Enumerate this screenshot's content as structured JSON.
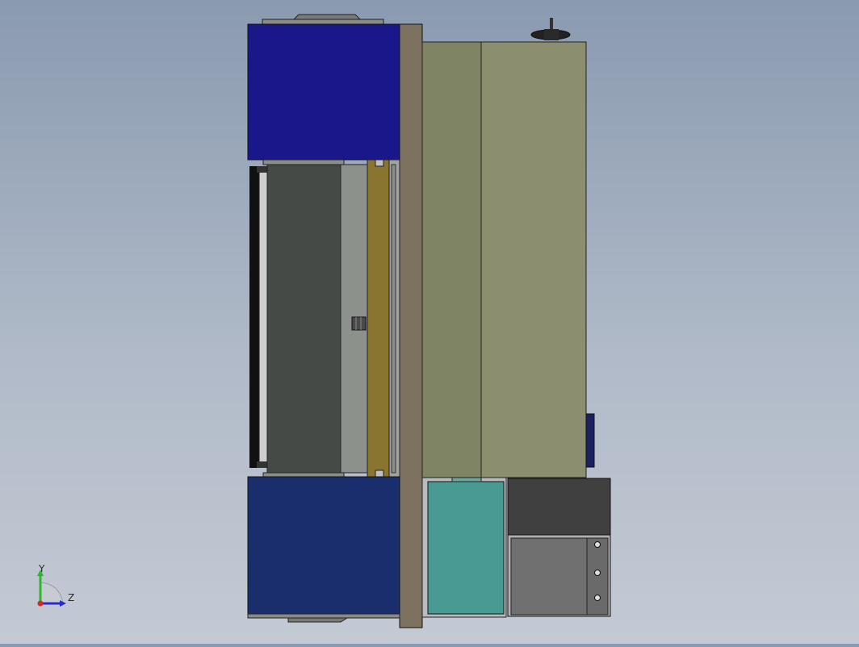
{
  "view": {
    "background_top": "#8a9ab0",
    "background_bottom": "#c4cad4"
  },
  "triad": {
    "y_label": "Y",
    "z_label": "Z",
    "y_color": "#2fb52f",
    "z_color": "#2a2ad0",
    "origin_color": "#d02a2a"
  },
  "colors": {
    "blue_top": "#1a178a",
    "blue_bottom": "#1a2e6e",
    "plate": "#7d7260",
    "olive_left": "#7e8464",
    "olive_right": "#8c8f6f",
    "dark_gray": "#454a47",
    "mid_gray": "#8c918c",
    "gold": "#8a7530",
    "teal": "#4a9a94",
    "box_dark": "#404040",
    "box_gray": "#707070"
  }
}
